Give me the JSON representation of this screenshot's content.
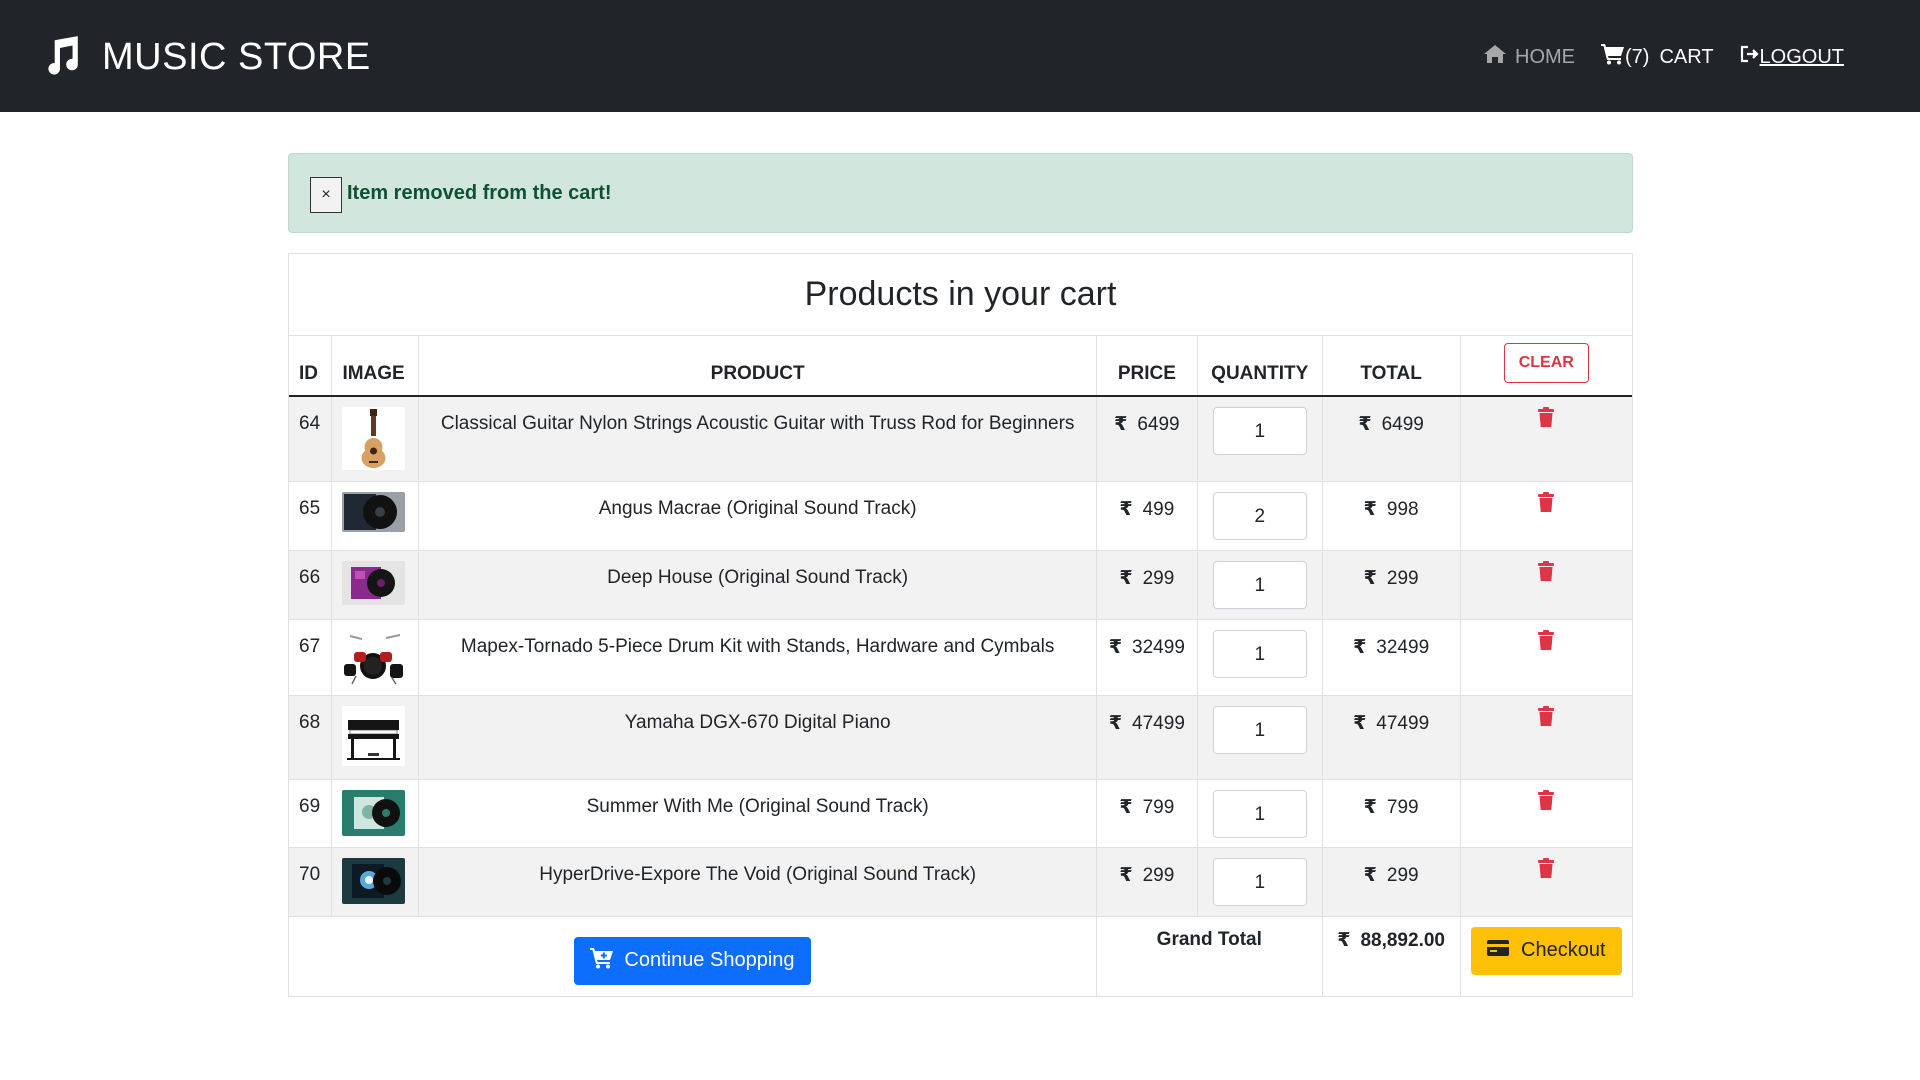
{
  "header": {
    "brand": "MUSIC STORE",
    "nav": {
      "home": "HOME",
      "cart_count": "(7)",
      "cart": "CART",
      "logout": "LOGOUT"
    }
  },
  "alert": {
    "close": "×",
    "message": "Item removed from the cart!"
  },
  "cart": {
    "title": "Products in your cart",
    "columns": [
      "ID",
      "IMAGE",
      "PRODUCT",
      "PRICE",
      "QUANTITY",
      "TOTAL"
    ],
    "clear_label": "CLEAR",
    "currency": "₹",
    "items": [
      {
        "id": "64",
        "product": "Classical Guitar Nylon Strings Acoustic Guitar with Truss Rod for Beginners",
        "price": "6499",
        "quantity": "1",
        "total": "6499",
        "image": "guitar"
      },
      {
        "id": "65",
        "product": "Angus Macrae (Original Sound Track)",
        "price": "499",
        "quantity": "2",
        "total": "998",
        "image": "vinyl-dark"
      },
      {
        "id": "66",
        "product": "Deep House (Original Sound Track)",
        "price": "299",
        "quantity": "1",
        "total": "299",
        "image": "vinyl-purple"
      },
      {
        "id": "67",
        "product": "Mapex-Tornado 5-Piece Drum Kit with Stands, Hardware and Cymbals",
        "price": "32499",
        "quantity": "1",
        "total": "32499",
        "image": "drum-kit"
      },
      {
        "id": "68",
        "product": "Yamaha DGX-670 Digital Piano",
        "price": "47499",
        "quantity": "1",
        "total": "47499",
        "image": "piano"
      },
      {
        "id": "69",
        "product": "Summer With Me (Original Sound Track)",
        "price": "799",
        "quantity": "1",
        "total": "799",
        "image": "vinyl-teal"
      },
      {
        "id": "70",
        "product": "HyperDrive-Expore The Void (Original Sound Track)",
        "price": "299",
        "quantity": "1",
        "total": "299",
        "image": "vinyl-space"
      }
    ],
    "footer": {
      "continue_label": "Continue Shopping",
      "grand_total_label": "Grand Total",
      "grand_total_value": "88,892.00",
      "checkout_label": "Checkout"
    }
  },
  "colors": {
    "navbar": "#212529",
    "alert_bg": "#d1e7dd",
    "danger": "#dc3545",
    "primary": "#0d6efd",
    "warning": "#ffc107"
  }
}
